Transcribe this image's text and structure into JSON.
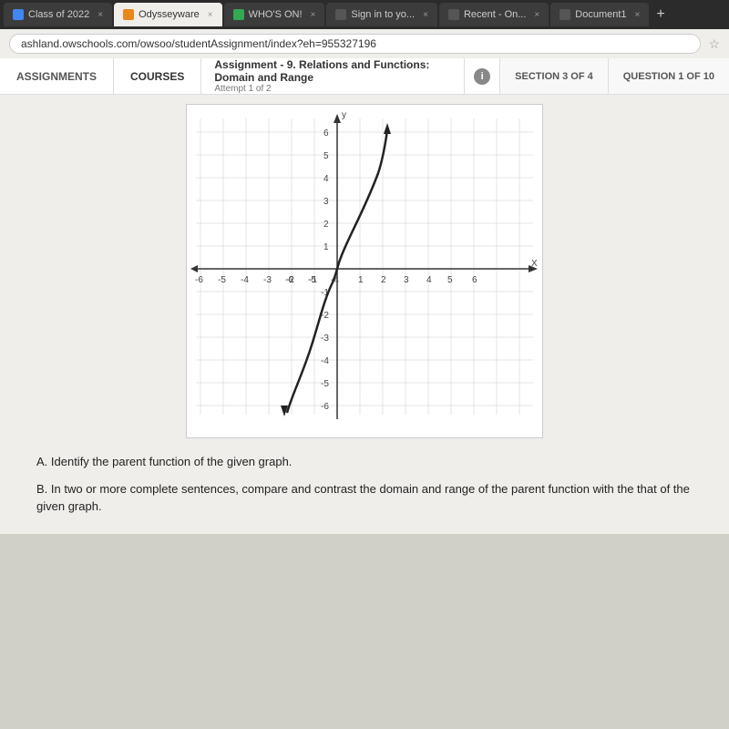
{
  "browser": {
    "tabs": [
      {
        "label": "Class of 2022",
        "icon": "blue",
        "active": false
      },
      {
        "label": "Odysseyware",
        "icon": "orange",
        "active": true
      },
      {
        "label": "WHO'S ON!",
        "icon": "green",
        "active": false
      },
      {
        "label": "Sign in to yo...",
        "icon": "dark",
        "active": false
      },
      {
        "label": "Recent - On...",
        "icon": "dark",
        "active": false
      },
      {
        "label": "Document1",
        "icon": "dark",
        "active": false
      }
    ],
    "address": "ashland.owschools.com/owsoo/studentAssignment/index?eh=955327196"
  },
  "header": {
    "assignments_label": "ASSIGNMENTS",
    "courses_label": "COURSES",
    "assignment_title": "Assignment  - 9. Relations and Functions: Domain and Range",
    "assignment_subtitle": "Attempt 1 of 2",
    "section_label": "SECTION 3 OF 4",
    "question_label": "QUESTION 1 OF 10"
  },
  "questions": {
    "part_a": "A. Identify the parent function of the given graph.",
    "part_b": "B. In two or more complete sentences, compare and contrast the domain and range of the parent function with the that of the given graph."
  },
  "graph": {
    "x_label": "X",
    "y_label": "y",
    "x_min": -6,
    "x_max": 6,
    "y_min": -6,
    "y_max": 6
  }
}
